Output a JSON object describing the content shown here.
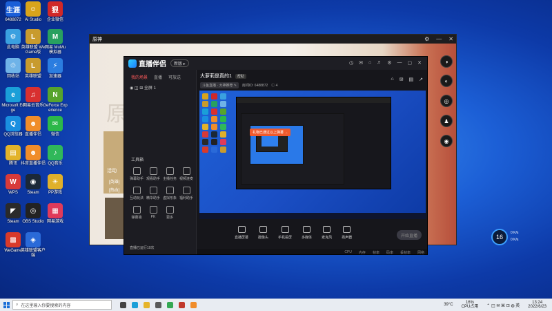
{
  "desktop_icons": [
    {
      "label": "6488872",
      "color": "#1b5fd8",
      "glyph": "生涯"
    },
    {
      "label": "Ai Studio",
      "color": "#d8a41b",
      "glyph": "☺"
    },
    {
      "label": "企业微信",
      "color": "#d02828",
      "glyph": "狠"
    },
    {
      "label": "此电脑",
      "color": "#3aa0e0",
      "glyph": "⚙"
    },
    {
      "label": "英雄联盟 WeGame版",
      "color": "#c89b2e",
      "glyph": "L"
    },
    {
      "label": "网易 MuMu模拟器",
      "color": "#28a060",
      "glyph": "M"
    },
    {
      "label": "回收站",
      "color": "#6fb3e8",
      "glyph": "♲"
    },
    {
      "label": "英雄联盟",
      "color": "#c89b2e",
      "glyph": "L"
    },
    {
      "label": "加速器",
      "color": "#2b7de0",
      "glyph": "⚡"
    },
    {
      "label": "Microsoft Edge",
      "color": "#1a9fd8",
      "glyph": "e"
    },
    {
      "label": "网易云音乐",
      "color": "#d83030",
      "glyph": "♫"
    },
    {
      "label": "GeForce Experience",
      "color": "#56a42d",
      "glyph": "N"
    },
    {
      "label": "QQ浏览器",
      "color": "#1a8fe0",
      "glyph": "Q"
    },
    {
      "label": "直播伴侣",
      "color": "#f08d2a",
      "glyph": "☻"
    },
    {
      "label": "微信",
      "color": "#2cb84a",
      "glyph": "✉"
    },
    {
      "label": "腾讯",
      "color": "#e3b32a",
      "glyph": "▤"
    },
    {
      "label": "抖音直播伴侣",
      "color": "#f08d2a",
      "glyph": "☻"
    },
    {
      "label": "QQ音乐",
      "color": "#30b85a",
      "glyph": "♪"
    },
    {
      "label": "WPS",
      "color": "#d83a3a",
      "glyph": "W"
    },
    {
      "label": "Steam",
      "color": "#1b2838",
      "glyph": "◉"
    },
    {
      "label": "PP游戏",
      "color": "#e0b02a",
      "glyph": "☀"
    },
    {
      "label": "Steam",
      "color": "#2a2a2a",
      "glyph": "◤"
    },
    {
      "label": "OBS Studio",
      "color": "#222222",
      "glyph": "◎"
    },
    {
      "label": "网易游戏",
      "color": "#e03a5a",
      "glyph": "▦"
    },
    {
      "label": "WeGame",
      "color": "#d83a2a",
      "glyph": "▩"
    },
    {
      "label": "英雄联盟客户端",
      "color": "#2a6ad8",
      "glyph": "◈"
    }
  ],
  "game_window": {
    "title": "原神",
    "title_big": "原",
    "activity": "活动",
    "tag1": "[英雄]",
    "tag2": "[热血]",
    "controls": [
      "⚙",
      "—",
      "✕"
    ]
  },
  "right_floating_icons": [
    "◑",
    "◐",
    "◎",
    "♟",
    "◉"
  ],
  "live_app": {
    "name": "直播伴侣",
    "version": "新版 ▸",
    "top_tools": [
      "◷",
      "✉",
      "⌂",
      "♬",
      "⚙",
      "—",
      "▢",
      "✕"
    ],
    "tabs": [
      "我的场景",
      "直播",
      "可放送"
    ],
    "scene_item": "◉  ◫  ⊞  全屏 1",
    "toolbox_title": "工具箱",
    "tools": [
      {
        "label": "弹幕助手"
      },
      {
        "label": "观看助手"
      },
      {
        "label": "主播任务"
      },
      {
        "label": "视频连麦"
      },
      {
        "label": "互动玩法"
      },
      {
        "label": "精华助手"
      },
      {
        "label": "虚拟形象"
      },
      {
        "label": "福利助手"
      },
      {
        "label": "弹幕墙"
      },
      {
        "label": "PK"
      },
      {
        "label": "更多"
      }
    ],
    "side_footer": "直播已运行10次",
    "room_title": "大萝莉是真的1",
    "room_chip": "帮助",
    "meta_pills": [
      "斗鱼直播 · 大神推荐 ✎",
      "房间ID: 6488872",
      "ⓘ 4"
    ],
    "header_icons": [
      "⌂",
      "✉",
      "▤",
      "↗"
    ],
    "toast": "礼物已通过以上弹幕 →",
    "bottom_buttons": [
      "直播屏幕",
      "摄像头",
      "手机投屏",
      "多媒体",
      "麦克风",
      "扬声器"
    ],
    "start_button": "开始直播",
    "status_items": [
      "CPU",
      "内存",
      "帧率",
      "码率",
      "丢帧率",
      "网络"
    ]
  },
  "widget": {
    "value": "16",
    "line1": "0 K/s",
    "line2": "0 K/s"
  },
  "taskbar": {
    "search_placeholder": "在这里输入你要搜索的内容",
    "weather": "39°C",
    "cpu_label": "16%",
    "cpu_sub": "CPU占用",
    "time": "13:24",
    "date": "2022/6/23",
    "icons": [
      {
        "name": "task-view",
        "color": "#444"
      },
      {
        "name": "edge",
        "color": "#1a9fd8"
      },
      {
        "name": "file-explorer",
        "color": "#e6b42a"
      },
      {
        "name": "store",
        "color": "#5a5a5a"
      },
      {
        "name": "chrome",
        "color": "#34a853"
      },
      {
        "name": "game",
        "color": "#c0392b"
      },
      {
        "name": "live",
        "color": "#f08d2a"
      }
    ]
  }
}
